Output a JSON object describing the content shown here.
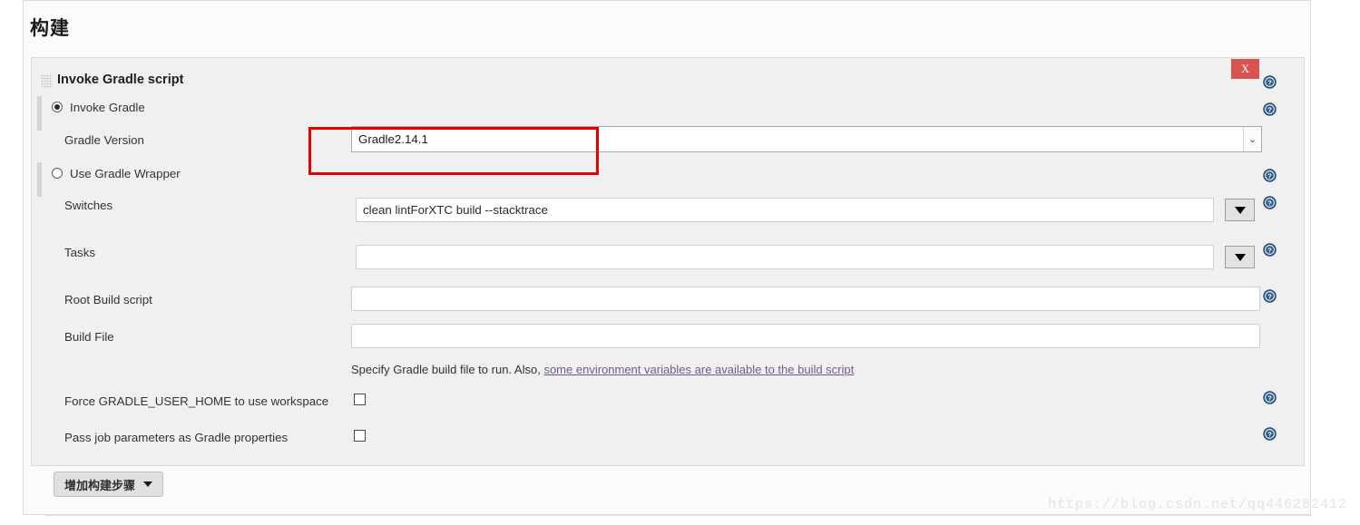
{
  "page": {
    "title": "构建"
  },
  "step": {
    "title": "Invoke Gradle script",
    "close_label": "X",
    "drag_handle_name": "drag-handle-icon"
  },
  "radios": [
    {
      "label": "Invoke Gradle",
      "checked": true
    },
    {
      "label": "Use Gradle Wrapper",
      "checked": false
    }
  ],
  "fields": {
    "gradle_version": {
      "label": "Gradle Version",
      "value": "Gradle2.14.1",
      "arrow": "⌄"
    },
    "switches": {
      "label": "Switches",
      "value": "clean lintForXTC build --stacktrace",
      "placeholder": ""
    },
    "tasks": {
      "label": "Tasks",
      "value": "",
      "placeholder": ""
    },
    "root_build_script": {
      "label": "Root Build script",
      "value": "",
      "placeholder": ""
    },
    "build_file": {
      "label": "Build File",
      "value": "",
      "placeholder": ""
    }
  },
  "help_text": {
    "prefix": "Specify Gradle build file to run. Also, ",
    "link": "some environment variables are available to the build script"
  },
  "checkboxes": [
    {
      "label": "Force GRADLE_USER_HOME to use workspace",
      "checked": false
    },
    {
      "label": "Pass job parameters as Gradle properties",
      "checked": false
    }
  ],
  "footer": {
    "add_step_label": "增加构建步骤"
  },
  "watermark": {
    "text": "https://blog.csdn.net/qq446282412"
  },
  "colors": {
    "close_button": "#d9534f",
    "annotation": "#e60000",
    "help_icon": "#35618e",
    "link": "#725a8c"
  }
}
